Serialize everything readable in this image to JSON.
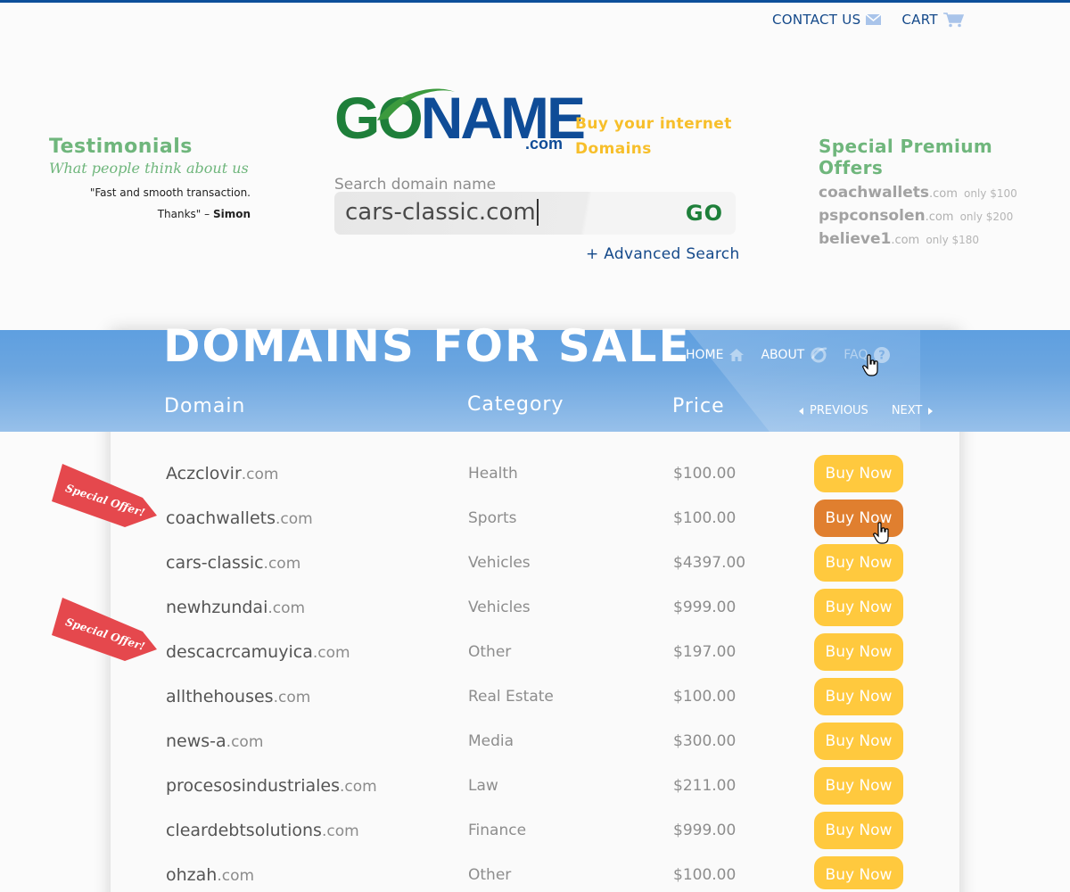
{
  "top_links": {
    "contact": "CONTACT US",
    "cart": "CART"
  },
  "testimonials": {
    "title": "Testimonials",
    "subtitle": "What people think about us",
    "quote_line1": "\"Fast and smooth transaction.",
    "quote_line2": "Thanks\" – ",
    "author": "Simon"
  },
  "logo": {
    "go": "GO",
    "name": "NAME",
    "com": ".com",
    "tagline_line1": "Buy your internet",
    "tagline_line2": "Domains"
  },
  "search": {
    "label": "Search domain name",
    "value": "cars-classic.com",
    "go_label": "GO",
    "advanced": "+ Advanced Search"
  },
  "premium": {
    "title": "Special Premium Offers",
    "items": [
      {
        "name": "coachwallets",
        "tld": ".com",
        "price": "only $100"
      },
      {
        "name": "pspconsolen",
        "tld": ".com",
        "price": "only $200"
      },
      {
        "name": "believe1",
        "tld": ".com",
        "price": "only $180"
      }
    ]
  },
  "band": {
    "title": "DOMAINS FOR SALE",
    "nav": {
      "home": "HOME",
      "about": "ABOUT",
      "faq": "FAQ"
    },
    "columns": {
      "domain": "Domain",
      "category": "Category",
      "price": "Price"
    },
    "pager": {
      "previous": "PREVIOUS",
      "next": "NEXT"
    }
  },
  "ribbon_label": "Special Offer!",
  "buy_label": "Buy Now",
  "rows": [
    {
      "name": "Aczclovir",
      "tld": ".com",
      "category": "Health",
      "price": "$100.00"
    },
    {
      "name": "coachwallets",
      "tld": ".com",
      "category": "Sports",
      "price": "$100.00"
    },
    {
      "name": "cars-classic",
      "tld": ".com",
      "category": "Vehicles",
      "price": "$4397.00"
    },
    {
      "name": "newhzundai",
      "tld": ".com",
      "category": "Vehicles",
      "price": "$999.00"
    },
    {
      "name": "descacrcamuyica",
      "tld": ".com",
      "category": "Other",
      "price": "$197.00"
    },
    {
      "name": "allthehouses",
      "tld": ".com",
      "category": "Real Estate",
      "price": "$100.00"
    },
    {
      "name": "news-a",
      "tld": ".com",
      "category": "Media",
      "price": "$300.00"
    },
    {
      "name": "procesosindustriales",
      "tld": ".com",
      "category": "Law",
      "price": "$211.00"
    },
    {
      "name": "cleardebtsolutions",
      "tld": ".com",
      "category": "Finance",
      "price": "$999.00"
    },
    {
      "name": "ohzah",
      "tld": ".com",
      "category": "Other",
      "price": "$100.00"
    }
  ],
  "colors": {
    "brand_blue": "#0f4c97",
    "brand_green": "#1e7f3a",
    "accent_green": "#6fb67c",
    "accent_yellow": "#f7bf2b",
    "buy_button": "#ffc93e",
    "buy_button_hover": "#e07f2f",
    "ribbon_red": "#e5484d",
    "band_blue": "#6ca6e0"
  }
}
